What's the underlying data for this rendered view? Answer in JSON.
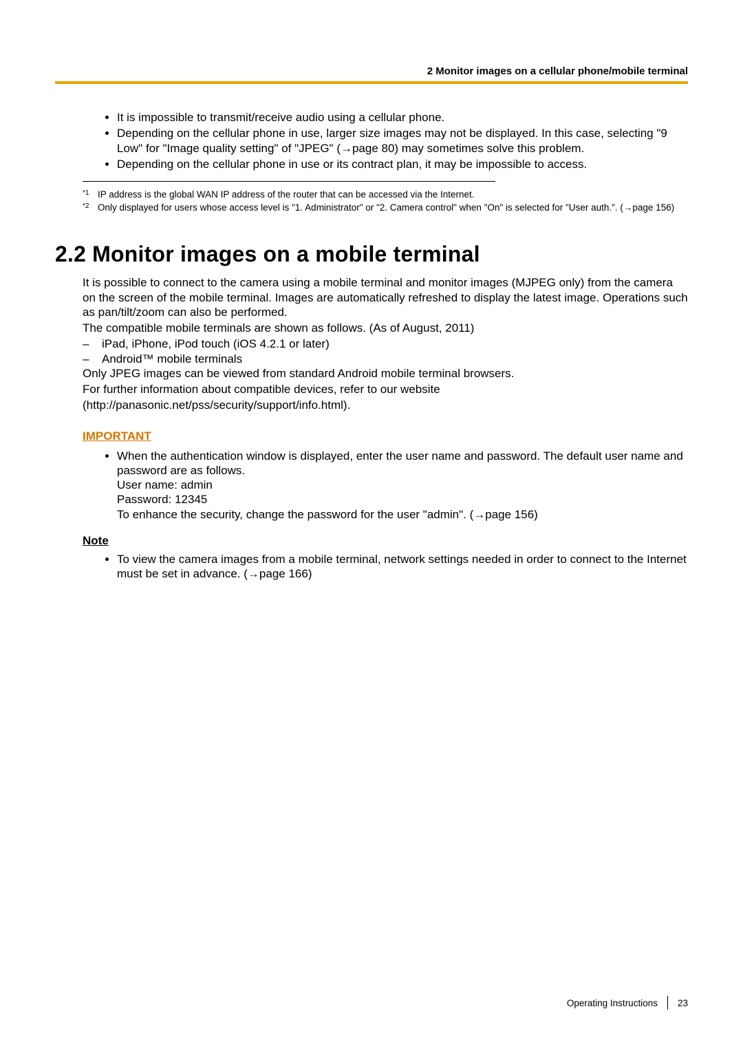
{
  "header": "2 Monitor images on a cellular phone/mobile terminal",
  "top_bullets": [
    "It is impossible to transmit/receive audio using a cellular phone.",
    "Depending on the cellular phone in use, larger size images may not be displayed. In this case, selecting \"9 Low\" for \"Image quality setting\" of \"JPEG\" (→page 80) may sometimes solve this problem.",
    "Depending on the cellular phone in use or its contract plan, it may be impossible to access."
  ],
  "footnotes": {
    "f1": {
      "label": "*1",
      "text": "IP address is the global WAN IP address of the router that can be accessed via the Internet."
    },
    "f2": {
      "label": "*2",
      "text": "Only displayed for users whose access level is \"1. Administrator\" or \"2. Camera control\" when \"On\" is selected for \"User auth.\". (→page 156)"
    }
  },
  "section_title": "2.2  Monitor images on a mobile terminal",
  "intro": {
    "p1": "It is possible to connect to the camera using a mobile terminal and monitor images (MJPEG only) from the camera on the screen of the mobile terminal. Images are automatically refreshed to display the latest image. Operations such as pan/tilt/zoom can also be performed.",
    "p2": "The compatible mobile terminals are shown as follows. (As of August, 2011)"
  },
  "compat_list": [
    "iPad, iPhone, iPod touch (iOS 4.2.1 or later)",
    "Android™ mobile terminals"
  ],
  "post": {
    "p1": "Only JPEG images can be viewed from standard Android mobile terminal browsers.",
    "p2": "For further information about compatible devices, refer to our website",
    "p3": "(http://panasonic.net/pss/security/support/info.html)."
  },
  "important_label": "IMPORTANT",
  "important_items": {
    "line1": "When the authentication window is displayed, enter the user name and password. The default user name and password are as follows.",
    "line2": "User name: admin",
    "line3": "Password: 12345",
    "line4": "To enhance the security, change the password for the user \"admin\". (→page 156)"
  },
  "note_label": "Note",
  "note_items": {
    "line1": "To view the camera images from a mobile terminal, network settings needed in order to connect to the Internet must be set in advance. (→page 166)"
  },
  "footer": {
    "doc": "Operating Instructions",
    "page": "23"
  }
}
